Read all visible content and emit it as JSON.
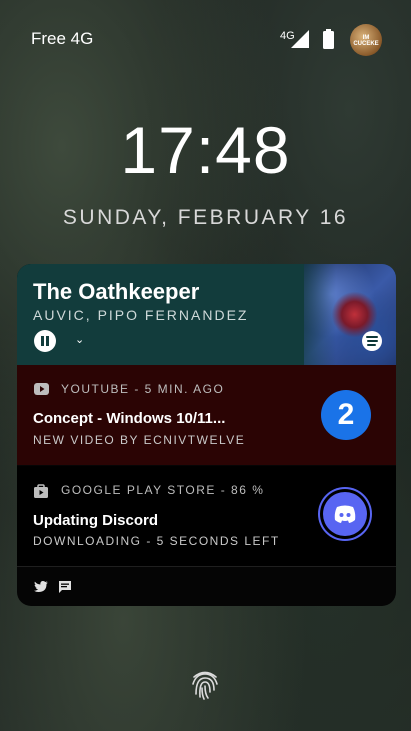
{
  "status_bar": {
    "carrier": "Free 4G",
    "network": "4G",
    "avatar_text": "IM\nCUCEKE"
  },
  "lock": {
    "time": "17:48",
    "date": "SUNDAY, FEBRUARY 16"
  },
  "media": {
    "song": "The Oathkeeper",
    "artist": "AUVIC, PIPO FERNANDEZ",
    "bg": "#123c3c"
  },
  "notifications": [
    {
      "app": "YOUTUBE",
      "time": "5 MIN. AGO",
      "header": "YOUTUBE - 5 MIN. AGO",
      "title": "Concept - Windows 10/11...",
      "subtitle": "NEW VIDEO BY ECNIVTWELVE",
      "badge": "2",
      "bg": "#2b0404"
    },
    {
      "app": "GOOGLE PLAY STORE",
      "progress": "86 %",
      "header": "GOOGLE PLAY STORE - 86 %",
      "title": "Updating Discord",
      "subtitle": "DOWNLOADING - 5 SECONDS LEFT",
      "bg": "#000000"
    }
  ],
  "icons": [
    "signal-icon",
    "battery-icon",
    "pause-icon",
    "expand-icon",
    "spotify-icon",
    "youtube-icon",
    "play-store-icon",
    "discord-icon",
    "twitter-icon",
    "message-icon",
    "fingerprint-icon"
  ]
}
